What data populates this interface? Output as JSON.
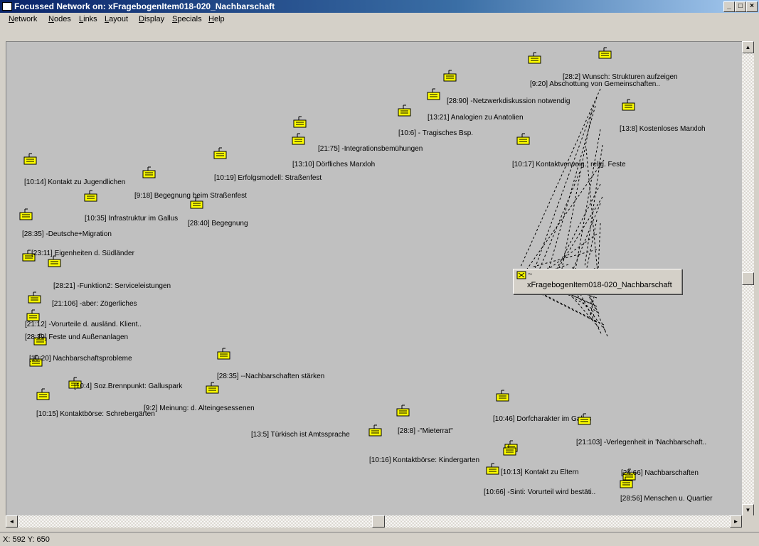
{
  "window": {
    "title": "Focussed Network on: xFragebogenItem018-020_Nachbarschaft"
  },
  "window_buttons": {
    "minimize": "_",
    "maximize": "□",
    "close": "×"
  },
  "menu": [
    "Network",
    "Nodes",
    "Links",
    "Layout",
    "Display",
    "Specials",
    "Help"
  ],
  "focus_node": {
    "prefix": "~",
    "label": "xFragebogenItem018-020_Nachbarschaft"
  },
  "nodes": [
    {
      "label": "[28:2] Wunsch: Strukturen aufzeigen"
    },
    {
      "label": "[9:20] Abschottung von Gemeinschaften.."
    },
    {
      "label": "[28:90] -Netzwerkdiskussion notwendig"
    },
    {
      "label": "[13:21] Analogien zu Anatolien"
    },
    {
      "label": "[13:8] Kostenloses Marxloh"
    },
    {
      "label": "[10:6] - Tragisches Bsp."
    },
    {
      "label": "[21:75] -Integrationsbemühungen"
    },
    {
      "label": "[13:10] Dörfliches Marxloh"
    },
    {
      "label": "[10:17] Kontaktverweig.: relig. Feste"
    },
    {
      "label": "[10:19] Erfolgsmodell: Straßenfest"
    },
    {
      "label": "[10:14] Kontakt zu Jugendlichen"
    },
    {
      "label": "[9:18] Begegnung beim Straßenfest"
    },
    {
      "label": "[10:35] Infrastruktur im Gallus"
    },
    {
      "label": "[28:40] Begegnung"
    },
    {
      "label": "[28:35] -Deutsche+Migration"
    },
    {
      "label": "[23:11] Eigenheiten d. Südländer"
    },
    {
      "label": "[28:21] -Funktion2: Serviceleistungen"
    },
    {
      "label": "[21:106] -aber: Zögerliches"
    },
    {
      "label": "[21:12] -Vorurteile d. ausländ. Klient.."
    },
    {
      "label": "[28:39] Feste und Außenanlagen"
    },
    {
      "label": "[10:20] Nachbarschaftsprobleme"
    },
    {
      "label": "[28:35] --Nachbarschaften stärken"
    },
    {
      "label": "[10:4] Soz.Brennpunkt: Galluspark"
    },
    {
      "label": "[10:15] Kontaktbörse: Schrebergärten"
    },
    {
      "label": "[9:2] Meinung: d. Alteingesessenen"
    },
    {
      "label": "[13:5] Türkisch ist Amtssprache"
    },
    {
      "label": "[28:8] -\"Mieterrat\""
    },
    {
      "label": "[10:16] Kontaktbörse: Kindergarten"
    },
    {
      "label": "[10:46] Dorfcharakter im Gallus"
    },
    {
      "label": "[21:103] -Verlegenheit in 'Nachbarschaft.."
    },
    {
      "label": "[10:13] Kontakt zu Eltern"
    },
    {
      "label": "[24:66] Nachbarschaften"
    },
    {
      "label": "[10:66] -Sinti: Vorurteil wird bestäti.."
    },
    {
      "label": "[28:56] Menschen u. Quartier"
    }
  ],
  "scroll": {
    "up": "▲",
    "down": "▼",
    "left": "◄",
    "right": "►"
  },
  "status": {
    "coords": "X: 592 Y: 650"
  },
  "colors": {
    "icon_yellow": "#ffff00",
    "canvas_bg": "#c0c0c0",
    "title_blue": "#0a246a"
  }
}
